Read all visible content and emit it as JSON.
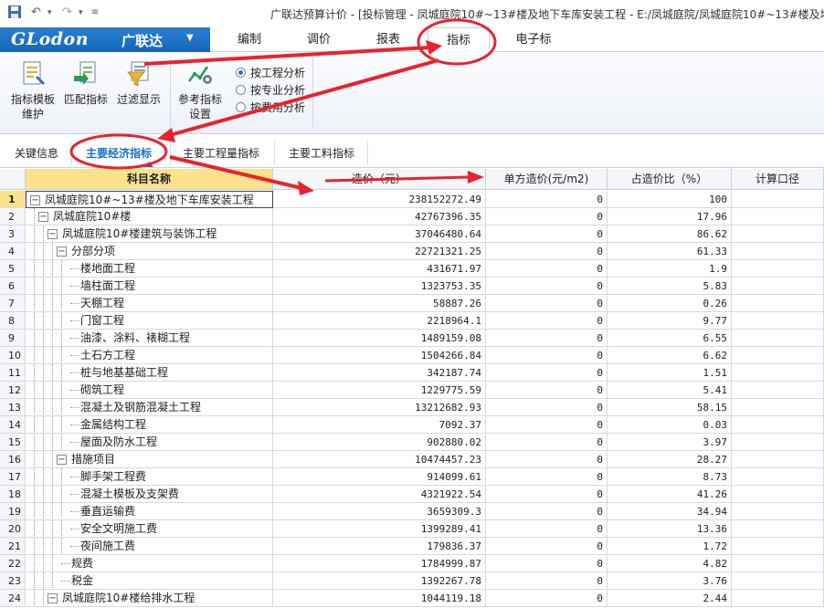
{
  "titlebar": {
    "title": "广联达预算计价 - [投标管理 - 凤城庭院10#~13#楼及地下车库安装工程 - E:/凤城庭院/凤城庭院10#~13#楼及地下"
  },
  "logo": {
    "brand": "GLodon",
    "brand_cn": "广联达",
    "caret": "▼"
  },
  "ribbon_tabs": [
    {
      "label": "编制"
    },
    {
      "label": "调价"
    },
    {
      "label": "报表"
    },
    {
      "label": "指标"
    },
    {
      "label": "电子标"
    }
  ],
  "ribbon": {
    "buttons": [
      {
        "label": "指标模板",
        "label2": "维护",
        "icon": "template-icon"
      },
      {
        "label": "匹配指标",
        "label2": "",
        "icon": "match-icon"
      },
      {
        "label": "过滤显示",
        "label2": "",
        "icon": "filter-icon"
      },
      {
        "label": "参考指标",
        "label2": "设置",
        "icon": "reference-icon"
      }
    ],
    "radios": [
      {
        "label": "按工程分析",
        "checked": true
      },
      {
        "label": "按专业分析",
        "checked": false
      },
      {
        "label": "按费用分析",
        "checked": false
      }
    ]
  },
  "sub_tabs": [
    {
      "label": "关键信息"
    },
    {
      "label": "主要经济指标"
    },
    {
      "label": "主要工程量指标"
    },
    {
      "label": "主要工料指标"
    }
  ],
  "grid": {
    "headers": [
      "科目名称",
      "造价（元）",
      "单方造价(元/m2)",
      "占造价比（%）",
      "计算口径"
    ],
    "rows": [
      {
        "idx": "1",
        "name": "凤城庭院10#~13#楼及地下车库安装工程",
        "cost": "238152272.49",
        "unit": "0",
        "ratio": "100",
        "level": 0,
        "exp": true
      },
      {
        "idx": "2",
        "name": "凤城庭院10#楼",
        "cost": "42767396.35",
        "unit": "0",
        "ratio": "17.96",
        "level": 1,
        "exp": true
      },
      {
        "idx": "3",
        "name": "凤城庭院10#楼建筑与装饰工程",
        "cost": "37046480.64",
        "unit": "0",
        "ratio": "86.62",
        "level": 2,
        "exp": true
      },
      {
        "idx": "4",
        "name": "分部分项",
        "cost": "22721321.25",
        "unit": "0",
        "ratio": "61.33",
        "level": 3,
        "exp": true
      },
      {
        "idx": "5",
        "name": "楼地面工程",
        "cost": "431671.97",
        "unit": "0",
        "ratio": "1.9",
        "level": 4,
        "exp": false
      },
      {
        "idx": "6",
        "name": "墙柱面工程",
        "cost": "1323753.35",
        "unit": "0",
        "ratio": "5.83",
        "level": 4,
        "exp": false
      },
      {
        "idx": "7",
        "name": "天棚工程",
        "cost": "58887.26",
        "unit": "0",
        "ratio": "0.26",
        "level": 4,
        "exp": false
      },
      {
        "idx": "8",
        "name": "门窗工程",
        "cost": "2218964.1",
        "unit": "0",
        "ratio": "9.77",
        "level": 4,
        "exp": false
      },
      {
        "idx": "9",
        "name": "油漆、涂料、裱糊工程",
        "cost": "1489159.08",
        "unit": "0",
        "ratio": "6.55",
        "level": 4,
        "exp": false
      },
      {
        "idx": "10",
        "name": "土石方工程",
        "cost": "1504266.84",
        "unit": "0",
        "ratio": "6.62",
        "level": 4,
        "exp": false
      },
      {
        "idx": "11",
        "name": "桩与地基基础工程",
        "cost": "342187.74",
        "unit": "0",
        "ratio": "1.51",
        "level": 4,
        "exp": false
      },
      {
        "idx": "12",
        "name": "砌筑工程",
        "cost": "1229775.59",
        "unit": "0",
        "ratio": "5.41",
        "level": 4,
        "exp": false
      },
      {
        "idx": "13",
        "name": "混凝土及钢筋混凝土工程",
        "cost": "13212682.93",
        "unit": "0",
        "ratio": "58.15",
        "level": 4,
        "exp": false
      },
      {
        "idx": "14",
        "name": "金属结构工程",
        "cost": "7092.37",
        "unit": "0",
        "ratio": "0.03",
        "level": 4,
        "exp": false
      },
      {
        "idx": "15",
        "name": "屋面及防水工程",
        "cost": "902880.02",
        "unit": "0",
        "ratio": "3.97",
        "level": 4,
        "exp": false
      },
      {
        "idx": "16",
        "name": "措施项目",
        "cost": "10474457.23",
        "unit": "0",
        "ratio": "28.27",
        "level": 3,
        "exp": true
      },
      {
        "idx": "17",
        "name": "脚手架工程费",
        "cost": "914099.61",
        "unit": "0",
        "ratio": "8.73",
        "level": 4,
        "exp": false
      },
      {
        "idx": "18",
        "name": "混凝土模板及支架费",
        "cost": "4321922.54",
        "unit": "0",
        "ratio": "41.26",
        "level": 4,
        "exp": false
      },
      {
        "idx": "19",
        "name": "垂直运输费",
        "cost": "3659309.3",
        "unit": "0",
        "ratio": "34.94",
        "level": 4,
        "exp": false
      },
      {
        "idx": "20",
        "name": "安全文明施工费",
        "cost": "1399289.41",
        "unit": "0",
        "ratio": "13.36",
        "level": 4,
        "exp": false
      },
      {
        "idx": "21",
        "name": "夜间施工费",
        "cost": "179836.37",
        "unit": "0",
        "ratio": "1.72",
        "level": 4,
        "exp": false
      },
      {
        "idx": "22",
        "name": "规费",
        "cost": "1784999.87",
        "unit": "0",
        "ratio": "4.82",
        "level": 3,
        "exp": false
      },
      {
        "idx": "23",
        "name": "税金",
        "cost": "1392267.78",
        "unit": "0",
        "ratio": "3.76",
        "level": 3,
        "exp": false
      },
      {
        "idx": "24",
        "name": "凤城庭院10#楼给排水工程",
        "cost": "1044119.18",
        "unit": "0",
        "ratio": "2.44",
        "level": 2,
        "exp": true
      }
    ]
  },
  "colors": {
    "accent": "#1a6fc7",
    "annotation": "#e8232e",
    "highlight": "#fbe38e"
  }
}
